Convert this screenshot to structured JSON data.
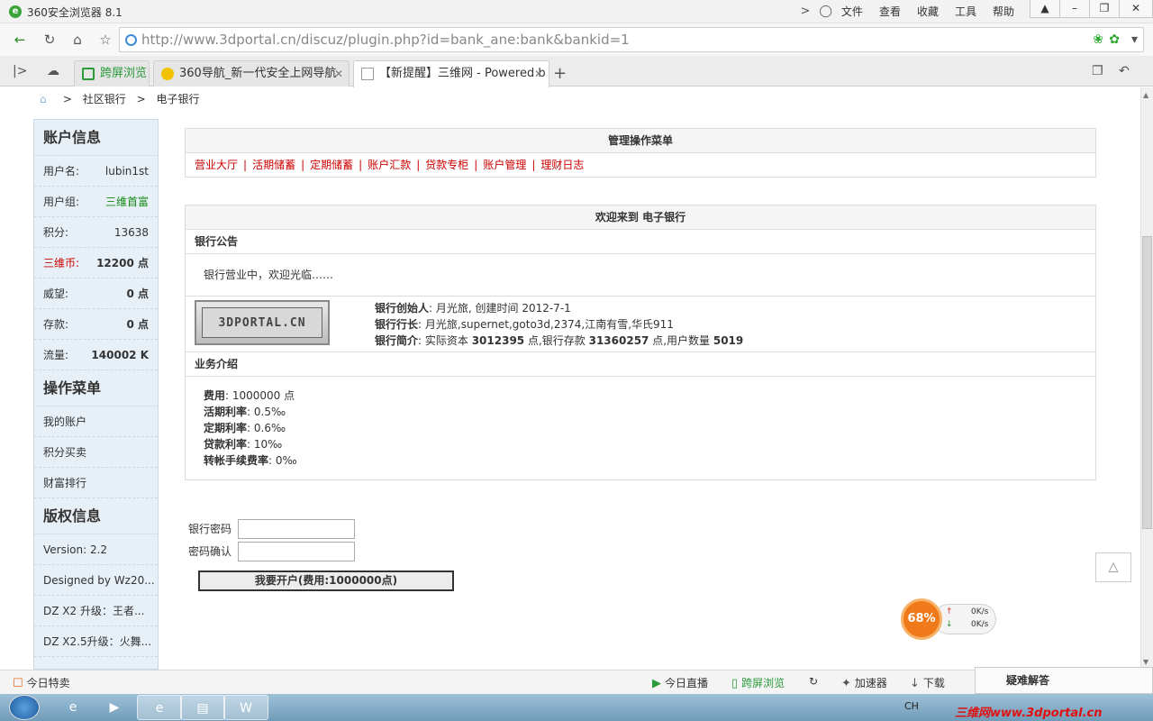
{
  "window": {
    "title": "360安全浏览器 8.1",
    "menu": [
      "文件",
      "查看",
      "收藏",
      "工具",
      "帮助"
    ],
    "controls": [
      "minimize",
      "restore",
      "close"
    ]
  },
  "navbar": {
    "url": "http://www.3dportal.cn/discuz/plugin.php?id=bank_ane:bank&bankid=1"
  },
  "tabs": [
    {
      "label": "跨屏浏览",
      "active": false
    },
    {
      "label": "360导航_新一代安全上网导航",
      "active": false
    },
    {
      "label": "【新提醒】三维网 - Powered b",
      "active": true
    }
  ],
  "breadcrumb": [
    ">",
    "社区银行",
    ">",
    "电子银行"
  ],
  "sidebar": {
    "account_title": "账户信息",
    "account_rows": [
      {
        "label": "用户名:",
        "value": "lubin1st"
      },
      {
        "label": "用户组:",
        "value": "三维首富"
      },
      {
        "label": "积分:",
        "value": "13638"
      },
      {
        "label": "三维币:",
        "value": "12200 点"
      },
      {
        "label": "威望:",
        "value": "0 点"
      },
      {
        "label": "存款:",
        "value": "0 点"
      },
      {
        "label": "流量:",
        "value": "140002 K"
      }
    ],
    "ops_title": "操作菜单",
    "ops": [
      "我的账户",
      "积分买卖",
      "财富排行"
    ],
    "copyright_title": "版权信息",
    "copyright": [
      "Version: 2.2",
      "Designed by Wz20...",
      "DZ X2 升级：王者...",
      "DZ X2.5升级：火舞..."
    ]
  },
  "main": {
    "menu_title": "管理操作菜单",
    "menu_links": [
      "营业大厅",
      "活期储蓄",
      "定期储蓄",
      "账户汇款",
      "贷款专柜",
      "账户管理",
      "理财日志"
    ],
    "welcome_title": "欢迎来到 电子银行",
    "notice_header": "银行公告",
    "notice_text": "银行营业中，欢迎光临……",
    "logo_text": "3DPORTAL.CN",
    "info": {
      "founder_label": "银行创始人",
      "founder_value": ": 月光旅, 创建时间  2012-7-1",
      "president_label": "银行行长",
      "president_value": ": 月光旅,supernet,goto3d,2374,江南有雪,华氏911",
      "intro_label": "银行简介",
      "intro_prefix": ": 实际资本 ",
      "capital": "3012395",
      "mid": " 点,银行存款 ",
      "deposits": "31360257",
      "mid2": " 点,用户数量 ",
      "users": "5019"
    },
    "biz_header": "业务介绍",
    "biz": [
      {
        "label": "费用",
        "value": ": 1000000 点"
      },
      {
        "label": "活期利率",
        "value": ": 0.5‰"
      },
      {
        "label": "定期利率",
        "value": ": 0.6‰"
      },
      {
        "label": "贷款利率",
        "value": ": 10‰"
      },
      {
        "label": "转帐手续费率",
        "value": ": 0‰"
      }
    ]
  },
  "form": {
    "password_label": "银行密码",
    "confirm_label": "密码确认",
    "submit_label": "我要开户(费用:1000000点)"
  },
  "speed_widget": {
    "percent": "68%",
    "up": "0K/s",
    "down": "0K/s"
  },
  "statusbar": {
    "left": "今日特卖",
    "items": [
      "今日直播",
      "跨屏浏览",
      "加速器",
      "下载"
    ],
    "faq": "疑难解答"
  },
  "taskbar": {
    "lang": "CH",
    "watermark": "三维网www.3dportal.cn"
  },
  "colors": {
    "link_red": "#cc0000",
    "sidebar_bg": "#e8f0f7",
    "group_green": "#118811",
    "widget_orange": "#f07a1a"
  }
}
